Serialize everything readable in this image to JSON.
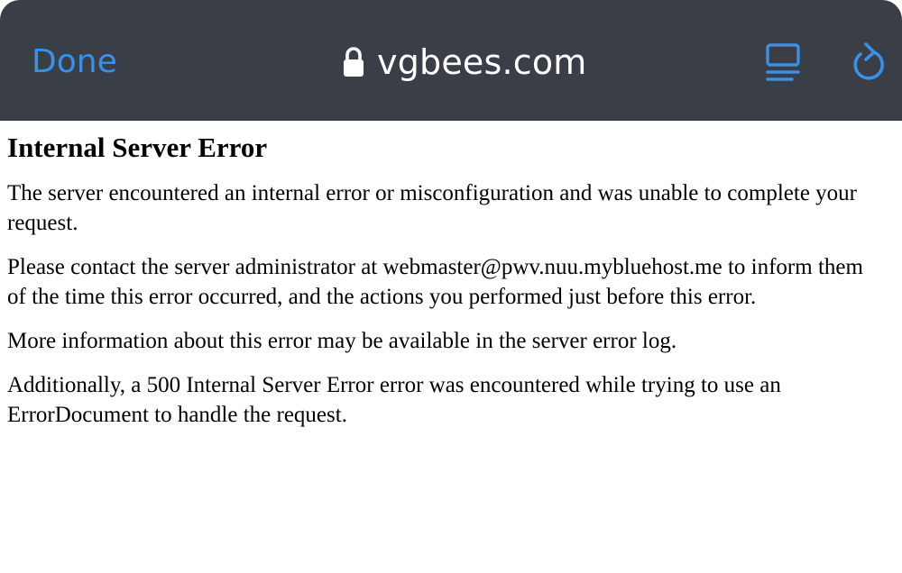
{
  "toolbar": {
    "done_label": "Done",
    "domain": "vgbees.com",
    "accent_color": "#3b8fe6",
    "background_color": "#3a3f47",
    "icons": {
      "secure": "lock-icon",
      "reader": "reader-view-icon",
      "reload": "reload-icon"
    }
  },
  "page": {
    "title": "Internal Server Error",
    "paragraphs": [
      {
        "lines": [
          "The server encountered an internal error or misconfiguration and was unable to complete your",
          "request."
        ]
      },
      {
        "lines": [
          "Please contact the server administrator at webmaster@pwv.nuu.mybluehost.me to inform them",
          "of the time this error occurred, and the actions you performed just before this error."
        ]
      },
      {
        "lines": [
          "More information about this error may be available in the server error log."
        ]
      },
      {
        "lines": [
          "Additionally, a 500 Internal Server Error error was encountered while trying to use an",
          "ErrorDocument to handle the request."
        ]
      }
    ]
  }
}
